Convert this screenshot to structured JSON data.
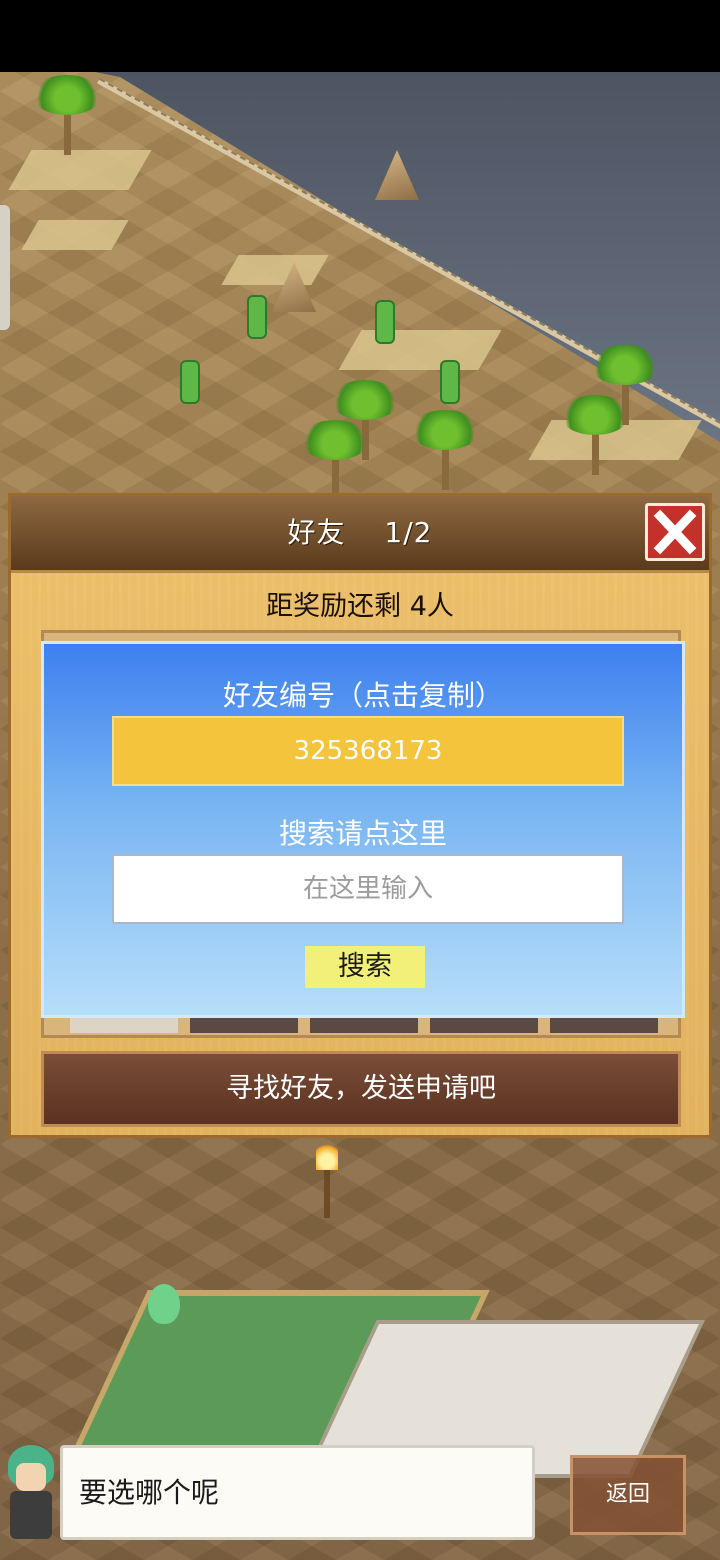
{
  "dialog": {
    "title": "好友　 1/2",
    "close_label": "",
    "reward_text": "距奖励还剩 4人",
    "friend_code_label": "好友编号（点击复制）",
    "friend_code": "325368173",
    "search_label": "搜索请点这里",
    "search_placeholder": "在这里输入",
    "search_button": "搜索",
    "send_request_button": "寻找好友，发送申请吧"
  },
  "bottom": {
    "message": "要选哪个呢",
    "back_button": "返回"
  },
  "colors": {
    "close_button": "#c4312a",
    "friend_code_box": "#f3c43c",
    "search_button": "#f3f07a",
    "panel_blue": "#3d80ef"
  },
  "icons": [
    "close-icon",
    "arrow-left-icon",
    "arrow-right-icon"
  ]
}
